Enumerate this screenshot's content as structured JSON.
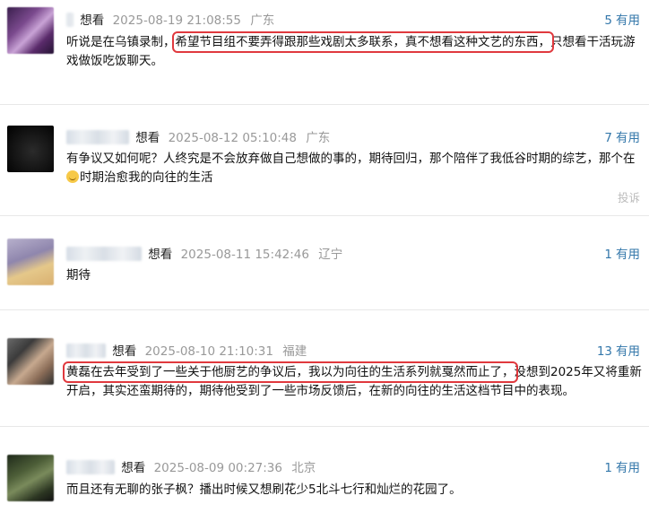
{
  "comments": [
    {
      "username": "",
      "action": "想看",
      "date": "2025-08-19 21:08:55",
      "location": "广东",
      "useful_count": "5",
      "useful_label": "有用",
      "text_before": "听说是在乌镇录制，",
      "text_highlight": "希望节目组不要弄得跟那些戏剧太多联系，真不想看这种文艺的东西，",
      "text_after": "只想看干活玩游戏做饭吃饭聊天。"
    },
    {
      "username": "",
      "action": "想看",
      "date": "2025-08-12 05:10:48",
      "location": "广东",
      "useful_count": "7",
      "useful_label": "有用",
      "text_before": "有争议又如何呢？人终究是不会放弃做自己想做的事的，期待回归，那个陪伴了我低谷时期的综艺，那个在",
      "text_after": "时期治愈我的向往的生活",
      "report": "投诉"
    },
    {
      "username": "",
      "action": "想看",
      "date": "2025-08-11 15:42:46",
      "location": "辽宁",
      "useful_count": "1",
      "useful_label": "有用",
      "text_before": "期待"
    },
    {
      "username": "",
      "action": "想看",
      "date": "2025-08-10 21:10:31",
      "location": "福建",
      "useful_count": "13",
      "useful_label": "有用",
      "text_highlight": "黄磊在去年受到了一些关于他厨艺的争议后，我以为向往的生活系列就戛然而止了，",
      "text_after": "没想到2025年又将重新开启，其实还蛮期待的，期待他受到了一些市场反馈后，在新的向往的生活这档节目中的表现。"
    },
    {
      "username": "",
      "action": "想看",
      "date": "2025-08-09 00:27:36",
      "location": "北京",
      "useful_count": "1",
      "useful_label": "有用",
      "text_before": "而且还有无聊的张子枫？播出时候又想刷花少5北斗七行和灿烂的花园了。"
    }
  ]
}
